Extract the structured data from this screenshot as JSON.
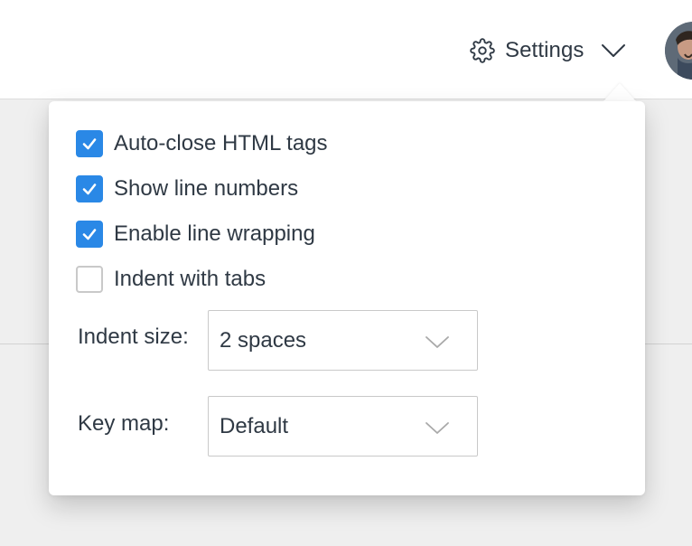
{
  "header": {
    "settings_label": "Settings",
    "settings_icon": "gear-icon",
    "chevron_icon": "chevron-down-icon",
    "avatar_icon": "user-avatar"
  },
  "settings_menu": {
    "options": [
      {
        "label": "Auto-close HTML tags",
        "checked": true
      },
      {
        "label": "Show line numbers",
        "checked": true
      },
      {
        "label": "Enable line wrapping",
        "checked": true
      },
      {
        "label": "Indent with tabs",
        "checked": false
      }
    ],
    "indent_size": {
      "label": "Indent size:",
      "value": "2 spaces"
    },
    "key_map": {
      "label": "Key map:",
      "value": "Default"
    }
  },
  "colors": {
    "accent": "#2a88e6",
    "text": "#2f3944",
    "panel_bg": "#ffffff",
    "page_bg": "#efefef"
  }
}
